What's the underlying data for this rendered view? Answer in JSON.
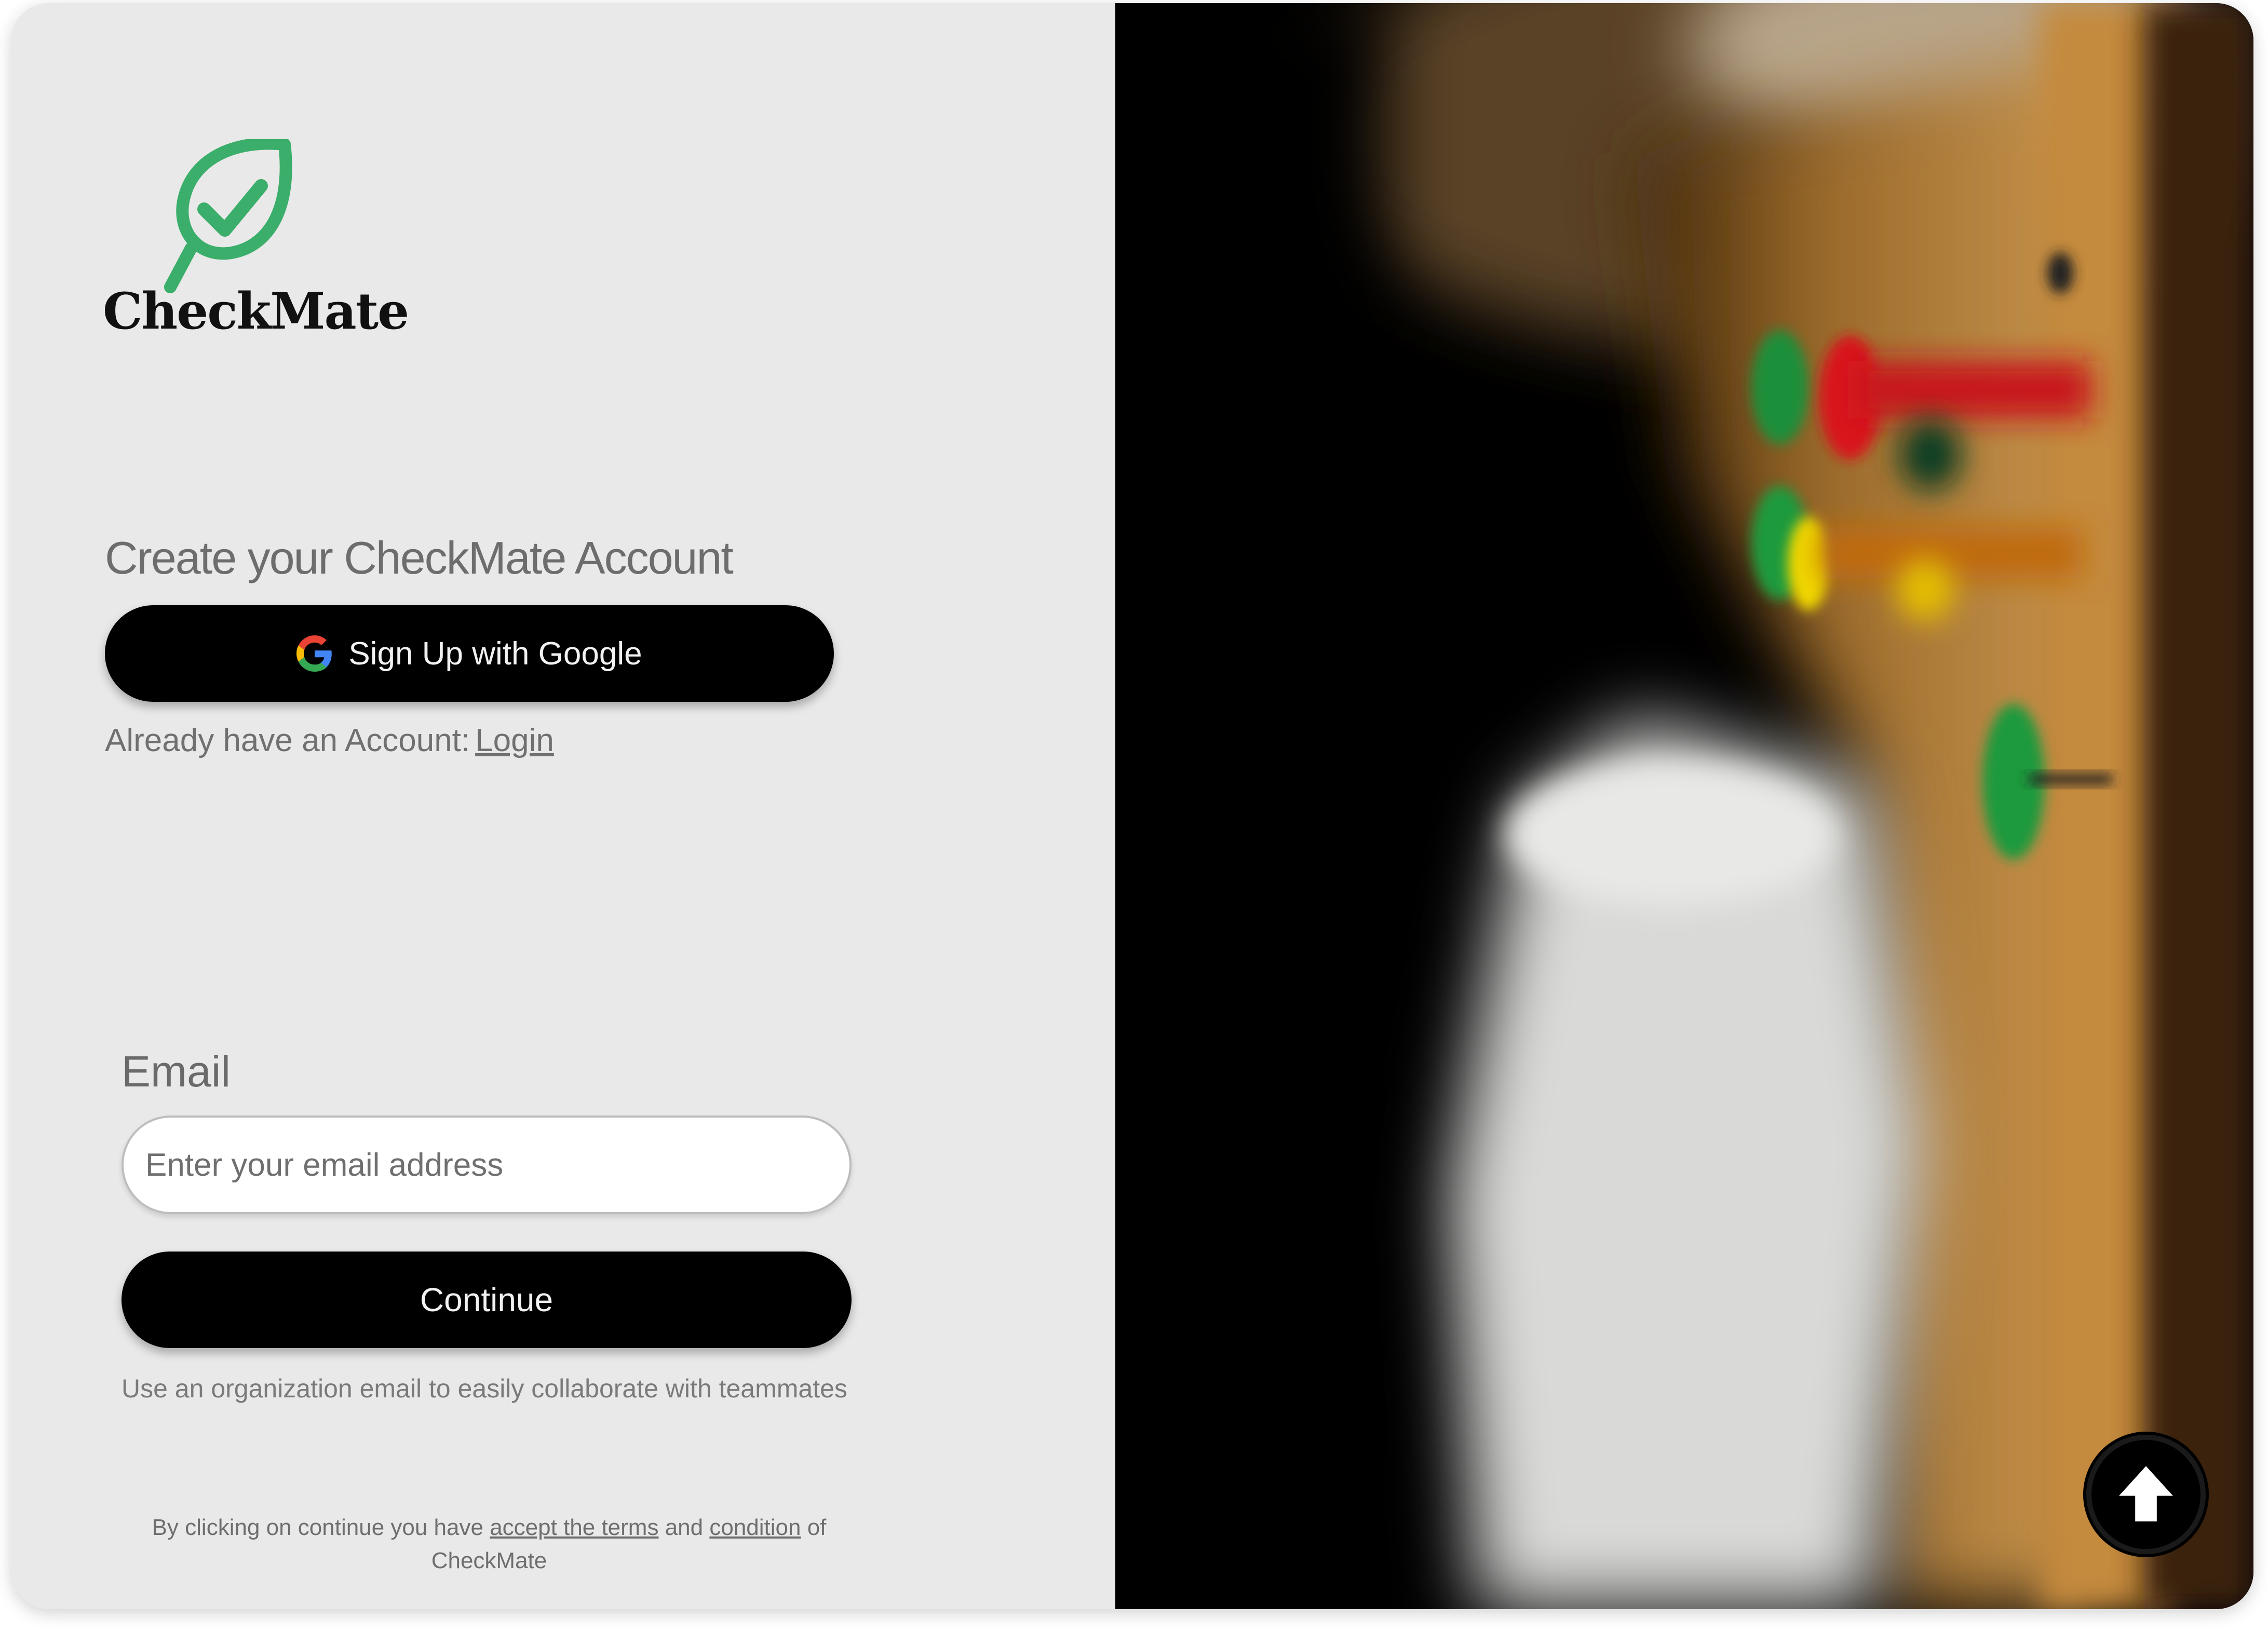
{
  "brand": {
    "name": "CheckMate",
    "accent_color": "#3aae6a"
  },
  "signup": {
    "heading": "Create your CheckMate Account",
    "google_button_label": "Sign Up  with Google",
    "already_text": "Already have an Account:",
    "login_link": "Login"
  },
  "email_form": {
    "label": "Email",
    "placeholder": "Enter your email address",
    "value": "",
    "continue_label": "Continue",
    "hint": "Use an organization email to easily collaborate with teammates"
  },
  "terms": {
    "prefix": "By clicking on continue you have ",
    "link_accept": "accept the terms",
    "middle": " and ",
    "link_condition": "condition",
    "suffix": " of CheckMate"
  },
  "hero": {
    "description_icon": "corkboard-photo",
    "upload_icon": "arrow-up-icon"
  }
}
